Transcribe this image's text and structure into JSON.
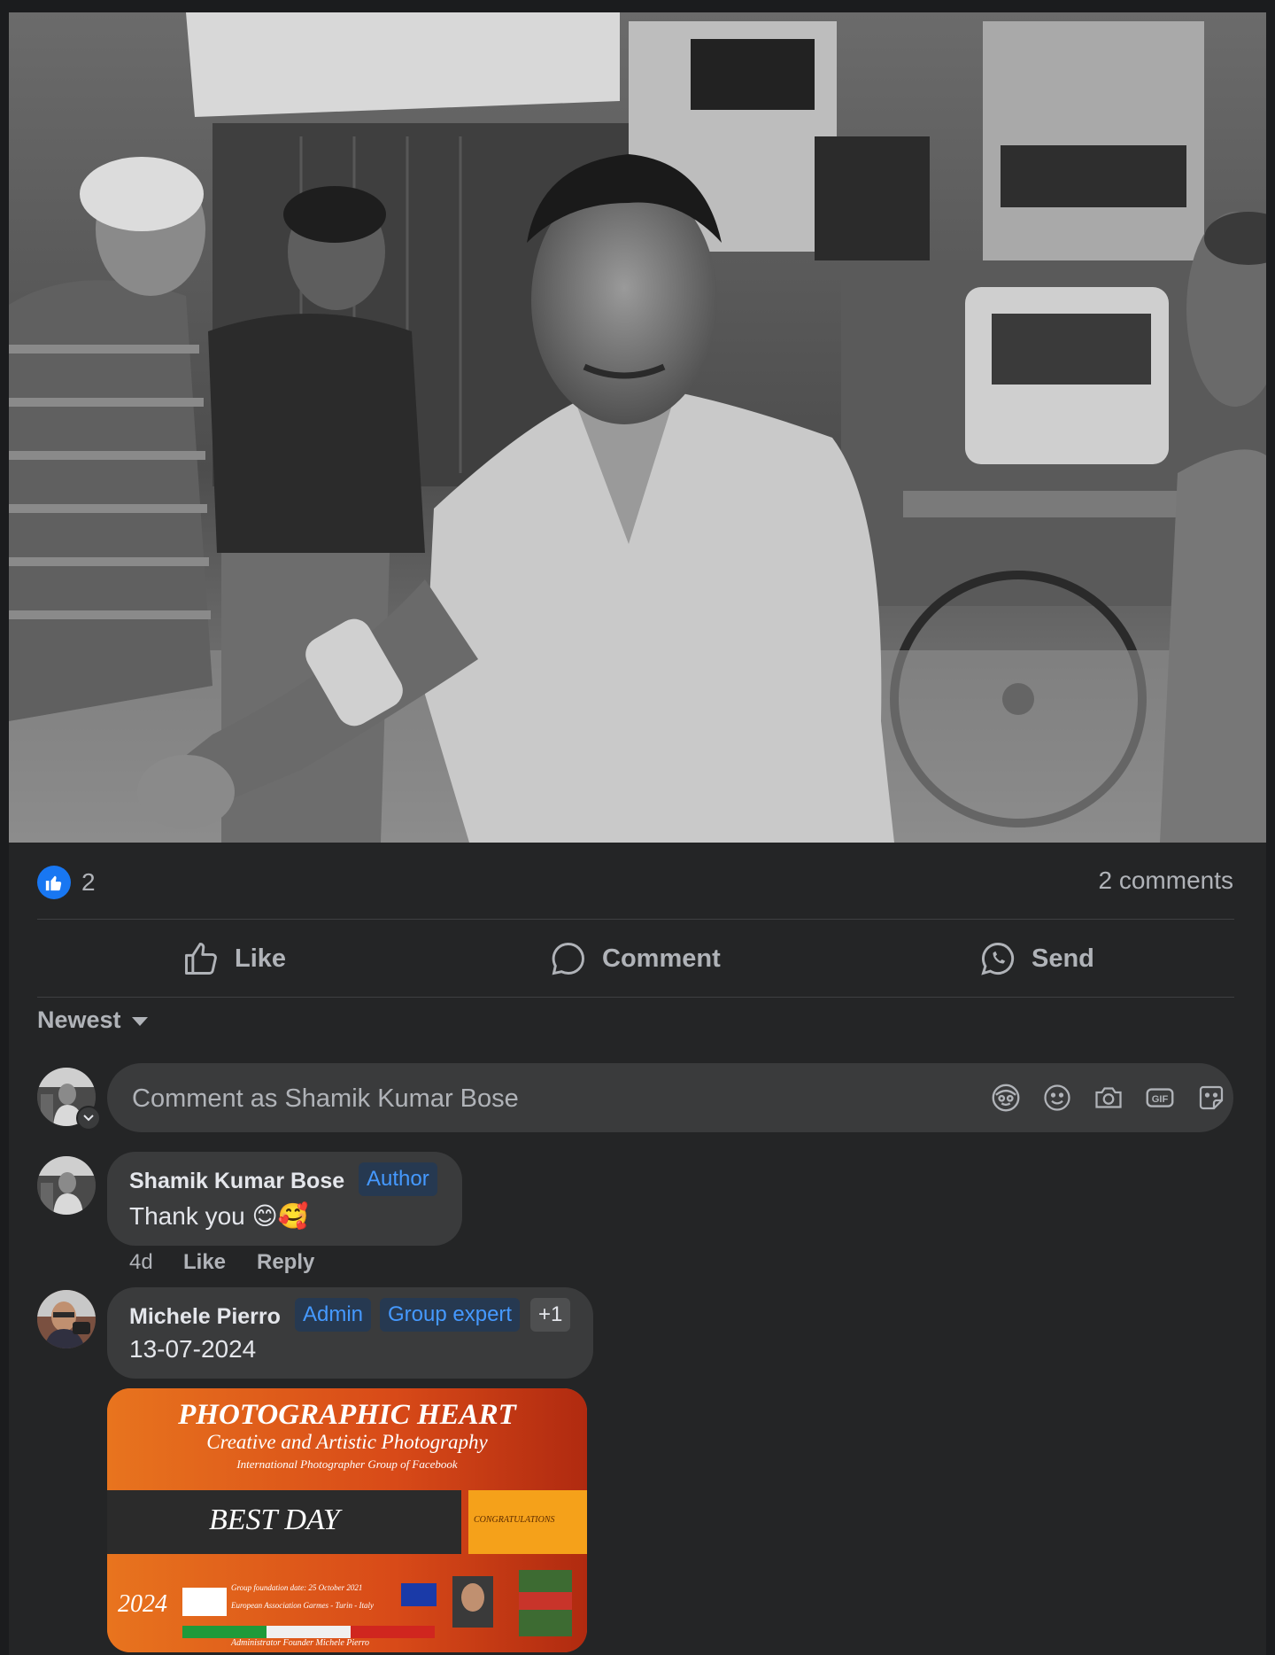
{
  "post": {
    "reaction_count": "2",
    "comments_count": "2 comments"
  },
  "actions": {
    "like": "Like",
    "comment": "Comment",
    "send": "Send"
  },
  "sort": {
    "label": "Newest"
  },
  "composer": {
    "placeholder": "Comment as Shamik Kumar Bose",
    "icons": [
      "avatar-sticker-icon",
      "emoji-icon",
      "camera-icon",
      "gif-icon",
      "sticker-icon"
    ],
    "gif_label": "GIF"
  },
  "comments": [
    {
      "author": "Shamik Kumar Bose",
      "badges": [
        "Author"
      ],
      "text": "Thank you 😊🥰",
      "time": "4d",
      "like": "Like",
      "reply": "Reply"
    },
    {
      "author": "Michele Pierro",
      "badges": [
        "Admin",
        "Group expert",
        "+1"
      ],
      "text": "13-07-2024",
      "attachment": {
        "title": "PHOTOGRAPHIC HEART",
        "subtitle": "Creative and Artistic Photography",
        "tagline": "International Photographer Group of Facebook",
        "headline": "BEST DAY",
        "congrats": "CONGRATULATIONS",
        "year": "2024",
        "line1": "Group foundation date: 25 October 2021",
        "line2": "European Association Garmes - Turin - Italy",
        "footer": "Administrator Founder Michele Pierro"
      }
    }
  ],
  "colors": {
    "background": "#242526",
    "bubble": "#3a3b3c",
    "text_primary": "#e4e6eb",
    "text_secondary": "#b0b3b8",
    "like_blue": "#1877f2",
    "badge_text": "#4599ff",
    "banner_orange": "#d9521a"
  }
}
